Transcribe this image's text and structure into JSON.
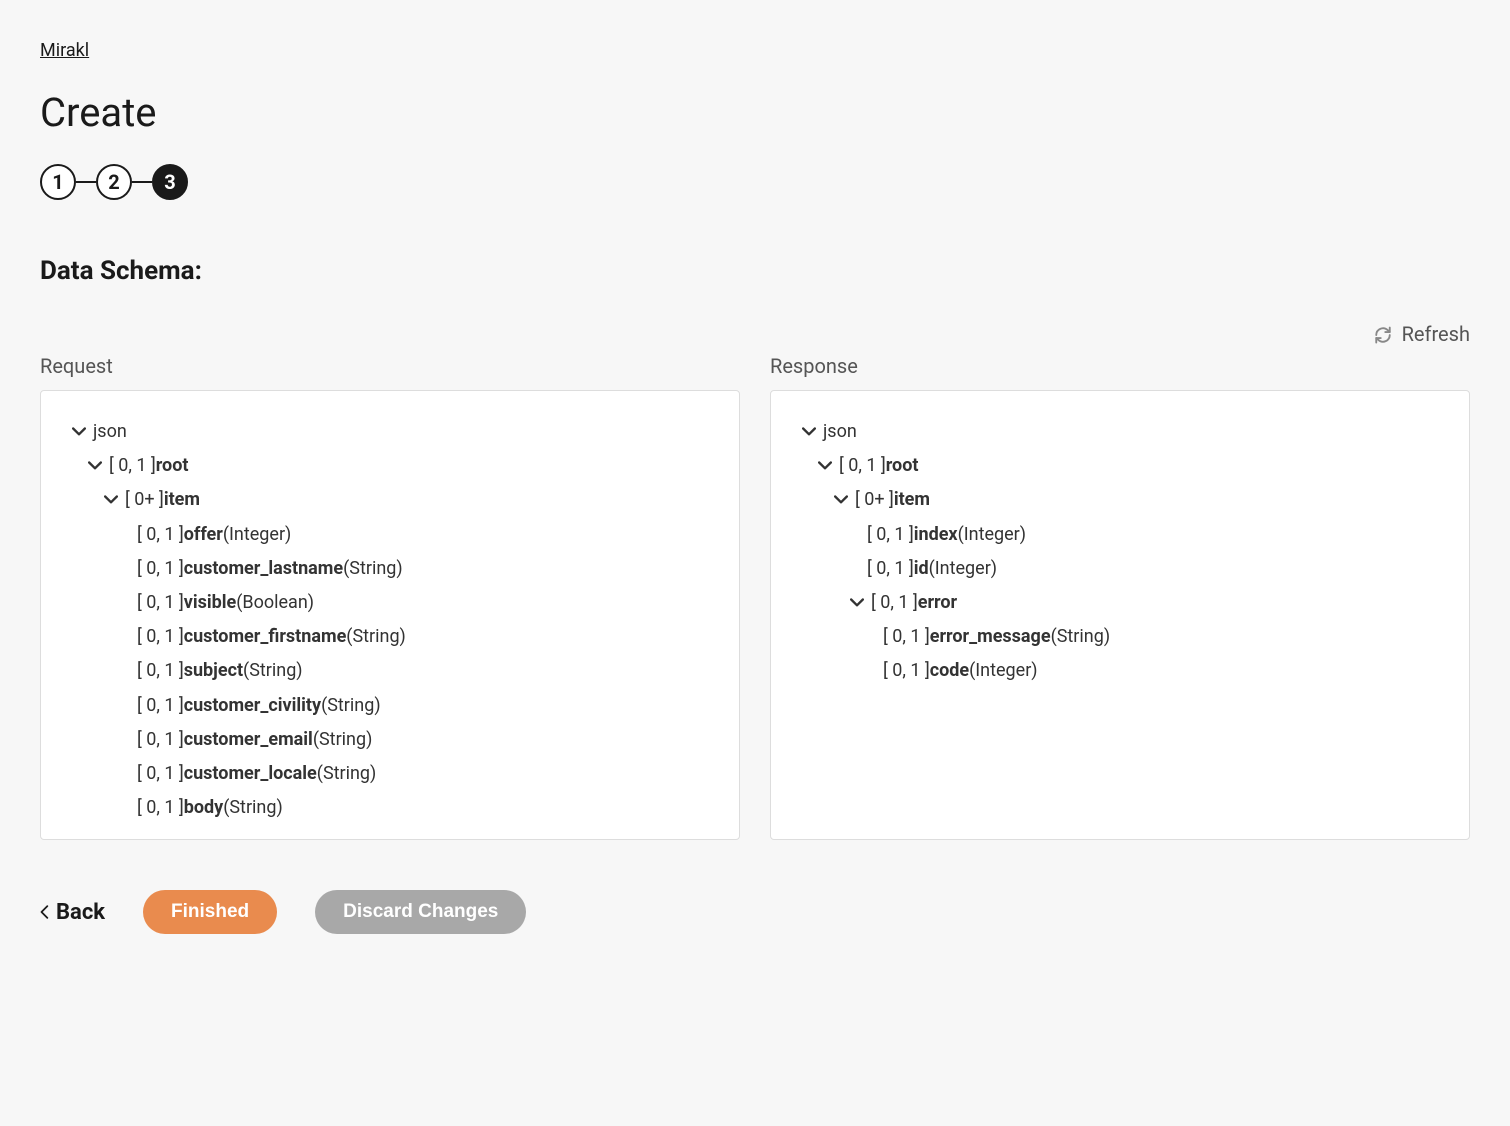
{
  "breadcrumb": "Mirakl",
  "page_title": "Create",
  "stepper": {
    "steps": [
      "1",
      "2",
      "3"
    ],
    "active_index": 2
  },
  "section_title": "Data Schema:",
  "refresh_label": "Refresh",
  "panels": {
    "request_label": "Request",
    "response_label": "Response"
  },
  "request_tree": [
    {
      "depth": 0,
      "chevron": true,
      "card": "",
      "name": "json",
      "type": "",
      "name_bold": false
    },
    {
      "depth": 1,
      "chevron": true,
      "card": "[ 0, 1 ] ",
      "name": "root",
      "type": "",
      "name_bold": true
    },
    {
      "depth": 2,
      "chevron": true,
      "card": "[ 0+ ] ",
      "name": "item",
      "type": "",
      "name_bold": true
    },
    {
      "depth": 3,
      "chevron": false,
      "card": "[ 0, 1 ] ",
      "name": "offer",
      "type": " (Integer)",
      "name_bold": true
    },
    {
      "depth": 3,
      "chevron": false,
      "card": "[ 0, 1 ] ",
      "name": "customer_lastname",
      "type": " (String)",
      "name_bold": true
    },
    {
      "depth": 3,
      "chevron": false,
      "card": "[ 0, 1 ] ",
      "name": "visible",
      "type": " (Boolean)",
      "name_bold": true
    },
    {
      "depth": 3,
      "chevron": false,
      "card": "[ 0, 1 ] ",
      "name": "customer_firstname",
      "type": " (String)",
      "name_bold": true
    },
    {
      "depth": 3,
      "chevron": false,
      "card": "[ 0, 1 ] ",
      "name": "subject",
      "type": " (String)",
      "name_bold": true
    },
    {
      "depth": 3,
      "chevron": false,
      "card": "[ 0, 1 ] ",
      "name": "customer_civility",
      "type": " (String)",
      "name_bold": true
    },
    {
      "depth": 3,
      "chevron": false,
      "card": "[ 0, 1 ] ",
      "name": "customer_email",
      "type": " (String)",
      "name_bold": true
    },
    {
      "depth": 3,
      "chevron": false,
      "card": "[ 0, 1 ] ",
      "name": "customer_locale",
      "type": " (String)",
      "name_bold": true
    },
    {
      "depth": 3,
      "chevron": false,
      "card": "[ 0, 1 ] ",
      "name": "body",
      "type": " (String)",
      "name_bold": true
    }
  ],
  "response_tree": [
    {
      "depth": 0,
      "chevron": true,
      "card": "",
      "name": "json",
      "type": "",
      "name_bold": false
    },
    {
      "depth": 1,
      "chevron": true,
      "card": "[ 0, 1 ] ",
      "name": "root",
      "type": "",
      "name_bold": true
    },
    {
      "depth": 2,
      "chevron": true,
      "card": "[ 0+ ] ",
      "name": "item",
      "type": "",
      "name_bold": true
    },
    {
      "depth": 3,
      "chevron": false,
      "card": "[ 0, 1 ] ",
      "name": "index",
      "type": " (Integer)",
      "name_bold": true
    },
    {
      "depth": 3,
      "chevron": false,
      "card": "[ 0, 1 ] ",
      "name": "id",
      "type": " (Integer)",
      "name_bold": true
    },
    {
      "depth": 3,
      "chevron": true,
      "card": "[ 0, 1 ] ",
      "name": "error",
      "type": "",
      "name_bold": true
    },
    {
      "depth": 4,
      "chevron": false,
      "card": "[ 0, 1 ] ",
      "name": "error_message",
      "type": " (String)",
      "name_bold": true
    },
    {
      "depth": 4,
      "chevron": false,
      "card": "[ 0, 1 ] ",
      "name": "code",
      "type": " (Integer)",
      "name_bold": true
    }
  ],
  "footer": {
    "back": "Back",
    "finished": "Finished",
    "discard": "Discard Changes"
  }
}
